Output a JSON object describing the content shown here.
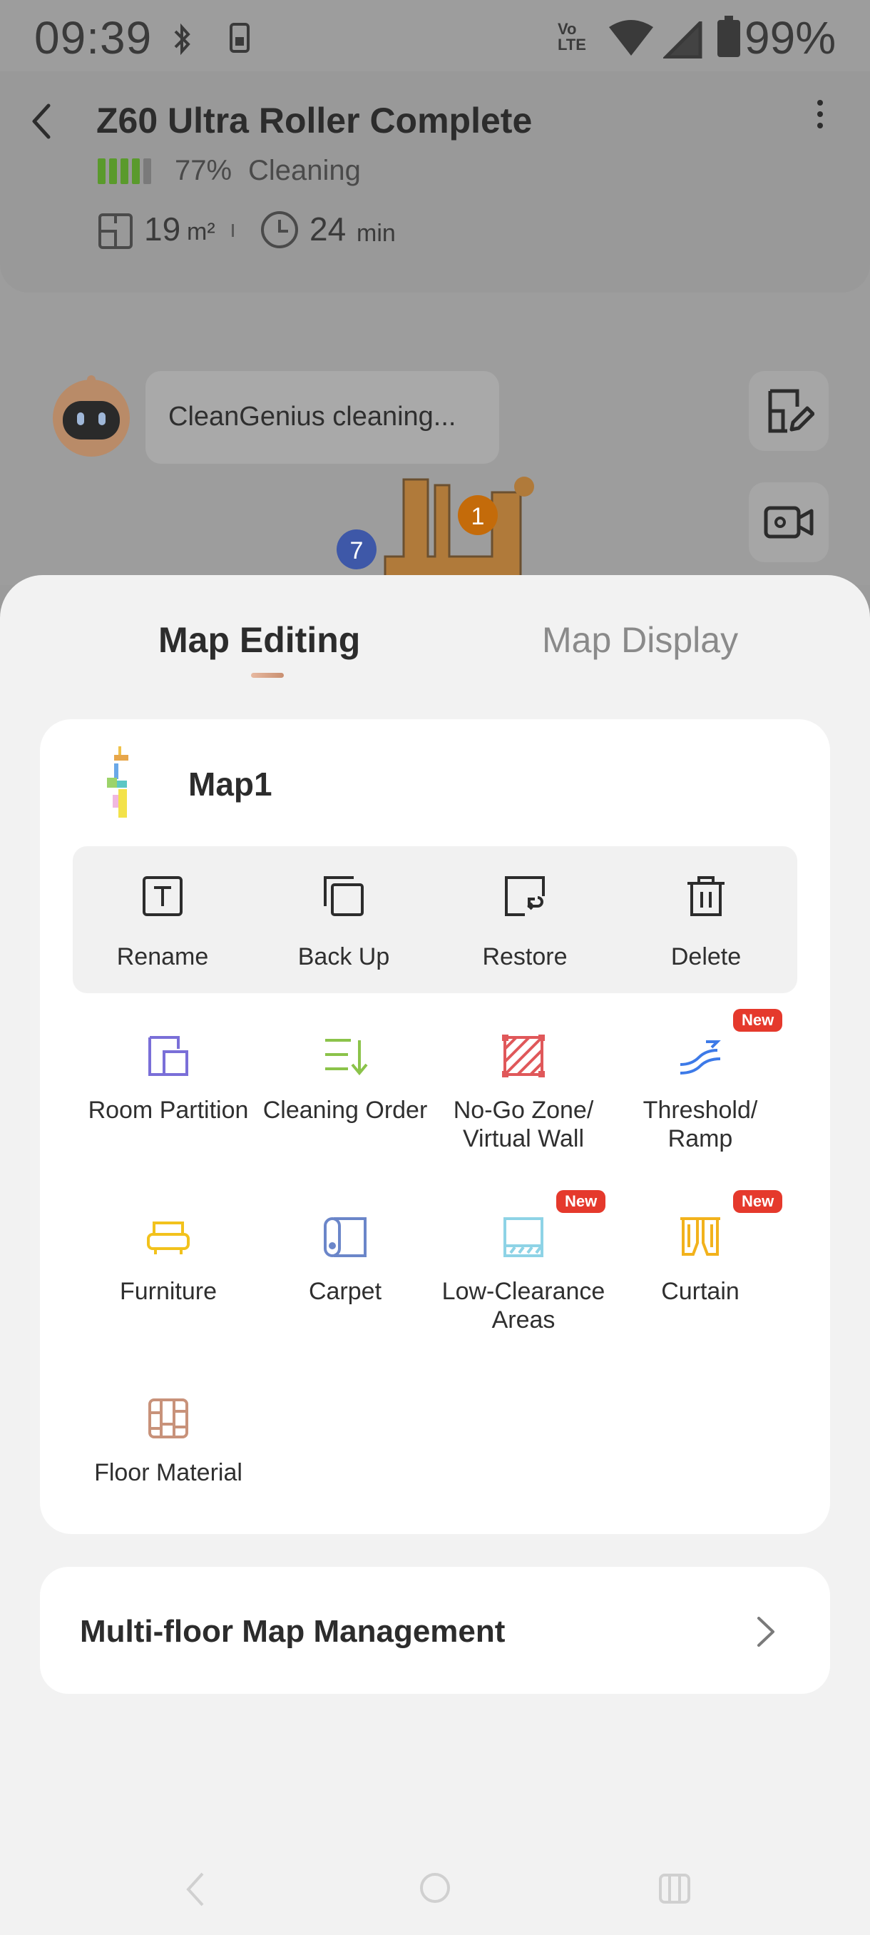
{
  "status_bar": {
    "time": "09:39",
    "volte_line1": "Vo",
    "volte_line2": "LTE",
    "battery_percent": "99%",
    "icons": [
      "bluetooth-icon",
      "sim-icon",
      "volte-icon",
      "wifi-icon",
      "signal-icon",
      "battery-icon"
    ]
  },
  "device": {
    "name": "Z60 Ultra Roller Complete",
    "battery": "77%",
    "battery_level": 0.77,
    "battery_color": "#5a9a2c",
    "status": "Cleaning",
    "area_value": "19",
    "area_unit": "m²",
    "time_value": "24",
    "time_unit": "min"
  },
  "assistant": {
    "message": "CleanGenius cleaning..."
  },
  "map_markers": {
    "room_1": "1",
    "room_7": "7"
  },
  "tabs": {
    "active": "Map Editing",
    "inactive": "Map Display"
  },
  "map": {
    "name": "Map1"
  },
  "operations": {
    "rename": "Rename",
    "back_up": "Back Up",
    "restore": "Restore",
    "delete": "Delete"
  },
  "tools": {
    "room_partition": "Room Partition",
    "cleaning_order": "Cleaning Order",
    "no_go_zone_line1": "No-Go Zone/",
    "no_go_zone_line2": "Virtual Wall",
    "threshold_line1": "Threshold/",
    "threshold_line2": "Ramp",
    "furniture": "Furniture",
    "carpet": "Carpet",
    "low_clearance_line1": "Low-Clearance",
    "low_clearance_line2": "Areas",
    "curtain": "Curtain",
    "floor_material": "Floor Material",
    "new_badge": "New"
  },
  "colors": {
    "accent": "#c98f70",
    "new_badge": "#e5392c",
    "room_partition": "#7a6fd8",
    "cleaning_order": "#8bc34a",
    "no_go": "#e0585a",
    "threshold": "#3d7ae8",
    "furniture": "#f2c21c",
    "carpet": "#6b86c9",
    "low_clearance": "#8ed3e6",
    "curtain": "#f2b21c",
    "floor_material": "#c8927a"
  },
  "multi_floor": {
    "label": "Multi-floor Map Management"
  }
}
